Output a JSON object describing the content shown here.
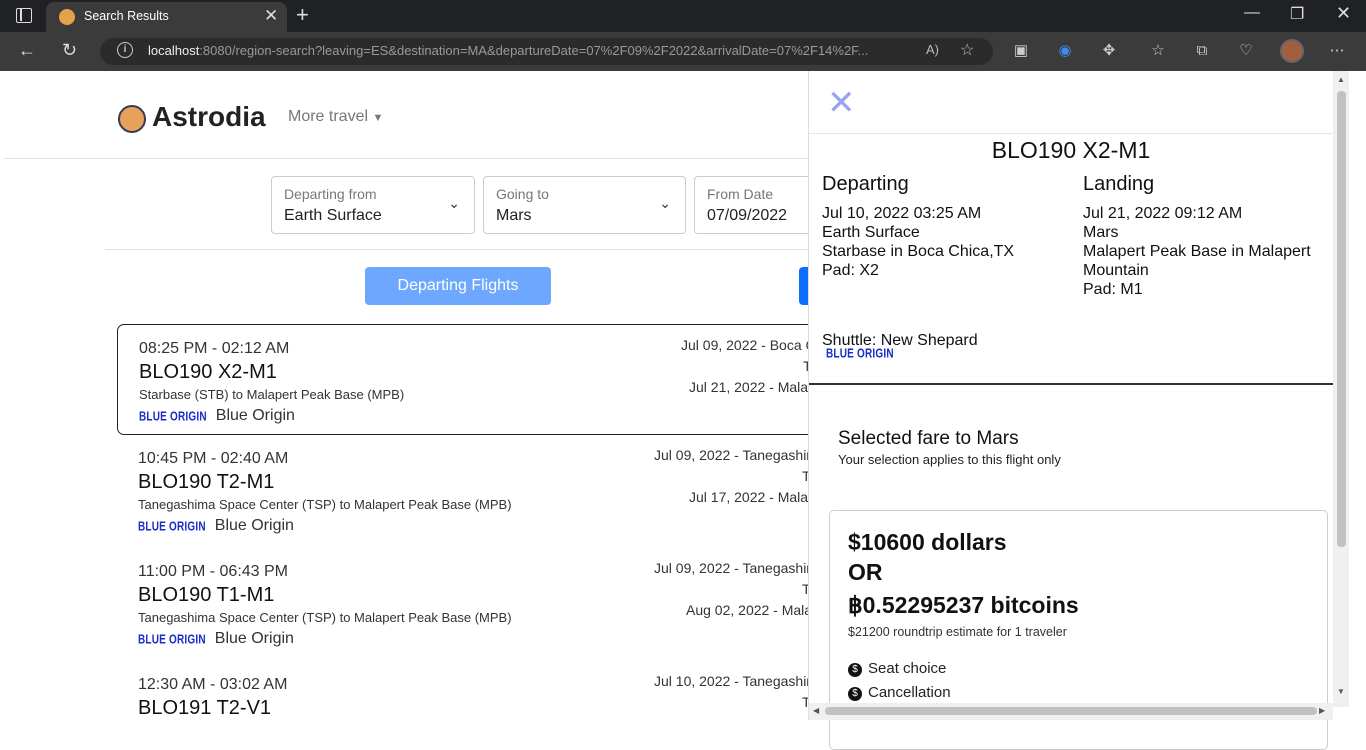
{
  "browser": {
    "tab_title": "Search Results",
    "url_host": "localhost",
    "url_rest": ":8080/region-search?leaving=ES&destination=MA&departureDate=07%2F09%2F2022&arrivalDate=07%2F14%2F..."
  },
  "site": {
    "logo": "Astrodia",
    "more_travel": "More travel"
  },
  "search": {
    "departing_label": "Departing from",
    "departing_value": "Earth Surface",
    "going_label": "Going to",
    "going_value": "Mars",
    "from_date_label": "From Date",
    "from_date_value": "07/09/2022"
  },
  "buttons": {
    "departing_flights": "Departing Flights"
  },
  "results": [
    {
      "time": "08:25 PM - 02:12 AM",
      "code": "BLO190 X2-M1",
      "route": "Starbase (STB) to Malapert Peak Base (MPB)",
      "airline": "Blue Origin",
      "dep": "Jul 09, 2022 - Boca C",
      "t": "T",
      "arr": "Jul 21, 2022 - Malap"
    },
    {
      "time": "10:45 PM - 02:40 AM",
      "code": "BLO190 T2-M1",
      "route": "Tanegashima Space Center (TSP) to Malapert Peak Base (MPB)",
      "airline": "Blue Origin",
      "dep": "Jul 09, 2022 - Tanegashim",
      "t": "T",
      "arr": "Jul 17, 2022 - Malap"
    },
    {
      "time": "11:00 PM - 06:43 PM",
      "code": "BLO190 T1-M1",
      "route": "Tanegashima Space Center (TSP) to Malapert Peak Base (MPB)",
      "airline": "Blue Origin",
      "dep": "Jul 09, 2022 - Tanegashim",
      "t": "T",
      "arr": "Aug 02, 2022 - Mala"
    },
    {
      "time": "12:30 AM - 03:02 AM",
      "code": "BLO191 T2-V1",
      "route": "",
      "airline": "",
      "dep": "Jul 10, 2022 - Tanegashim",
      "t": "T",
      "arr": ""
    }
  ],
  "airline_logo_text": "BLUE ORIGIN",
  "panel": {
    "title": "BLO190 X2-M1",
    "departing_heading": "Departing",
    "dep_datetime": "Jul 10, 2022 03:25 AM",
    "dep_place": "Earth Surface",
    "dep_base": "Starbase in Boca Chica,TX",
    "dep_pad": "Pad: X2",
    "landing_heading": "Landing",
    "land_datetime": "Jul 21, 2022 09:12 AM",
    "land_place": "Mars",
    "land_base_1": "Malapert Peak Base in Malapert",
    "land_base_2": "Mountain",
    "land_pad": "Pad: M1",
    "shuttle": "Shuttle: New Shepard",
    "fare_title": "Selected fare to Mars",
    "fare_sub": "Your selection applies to this flight only",
    "price_usd": "$10600 dollars",
    "price_or": "OR",
    "price_btc": "฿0.52295237 bitcoins",
    "roundtrip": "$21200 roundtrip estimate for 1 traveler",
    "features": [
      "Seat choice",
      "Cancellation"
    ]
  }
}
